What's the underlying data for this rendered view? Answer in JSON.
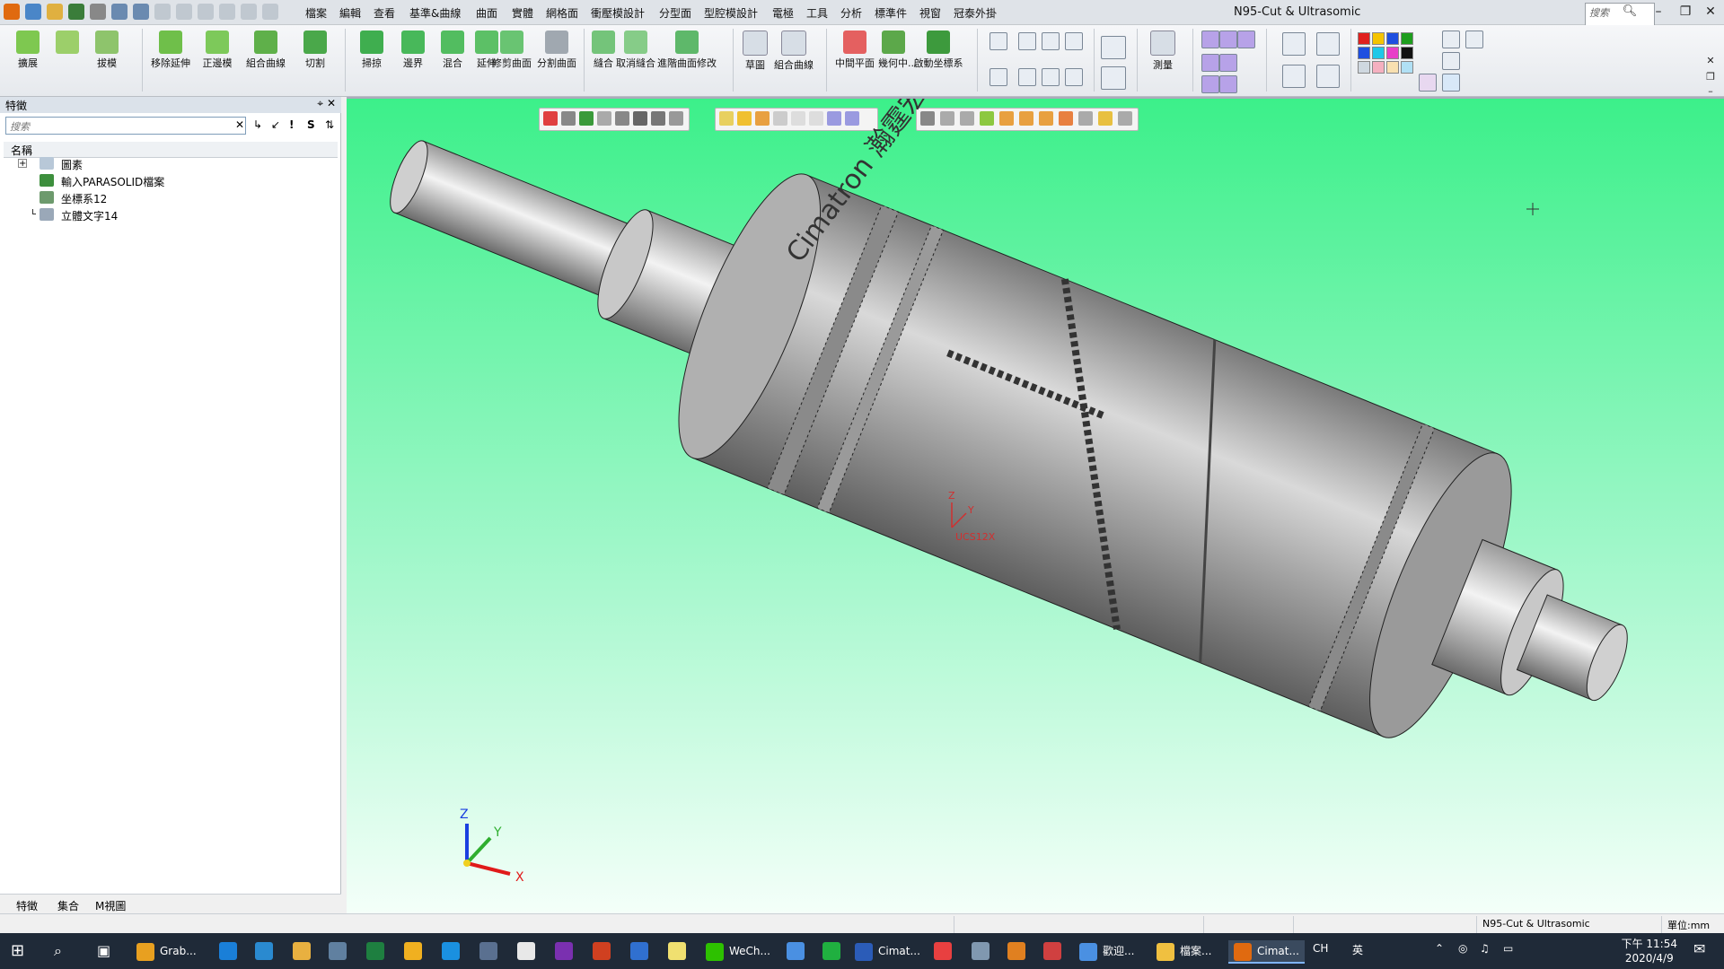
{
  "window": {
    "title": "N95-Cut & Ultrasomic"
  },
  "menubar": {
    "items": [
      "檔案",
      "編輯",
      "查看",
      "基準&曲線",
      "曲面",
      "實體",
      "網格面",
      "衝壓模設計",
      "分型面",
      "型腔模設計",
      "電極",
      "工具",
      "分析",
      "標準件",
      "視窗",
      "冠泰外掛"
    ],
    "search_placeholder": "搜索"
  },
  "ribbon": {
    "groups": [
      {
        "label": "擴展",
        "icon": "extend-icon"
      },
      {
        "label": "拔模",
        "icon": "draft-icon"
      },
      {
        "label": "移除延伸",
        "icon": "remove-extension-icon"
      },
      {
        "label": "正邊模",
        "icon": "edge-icon"
      },
      {
        "label": "組合曲線",
        "icon": "composite-curve-icon"
      },
      {
        "label": "切割",
        "icon": "cut-icon"
      },
      {
        "label": "掃掠",
        "icon": "sweep-icon"
      },
      {
        "label": "邊界",
        "icon": "boundary-icon"
      },
      {
        "label": "混合",
        "icon": "blend-icon"
      },
      {
        "label": "延伸",
        "icon": "extend-surface-icon"
      },
      {
        "label": "修剪曲面",
        "icon": "trim-surface-icon"
      },
      {
        "label": "分割曲面",
        "icon": "split-surface-icon"
      },
      {
        "label": "縫合",
        "icon": "stitch-icon"
      },
      {
        "label": "取消縫合",
        "icon": "unstitch-icon"
      },
      {
        "label": "進階曲面修改",
        "icon": "advanced-surface-icon"
      },
      {
        "label": "草圖",
        "icon": "sketch-icon"
      },
      {
        "label": "組合曲線",
        "icon": "combine-curve-icon"
      },
      {
        "label": "中間平面",
        "icon": "mid-plane-icon"
      },
      {
        "label": "幾何中...",
        "icon": "geometry-center-icon"
      },
      {
        "label": "啟動坐標系",
        "icon": "activate-ucs-icon"
      },
      {
        "label": "測量",
        "icon": "measure-icon"
      }
    ],
    "colors": [
      "#e0201e",
      "#f5c400",
      "#1e4fe0",
      "#1e9e1e",
      "#1e4fe0",
      "#1ec8e8",
      "#e83ec8",
      "#111111",
      "#cfd8e0",
      "#f5b0c0",
      "#f8e0b0",
      "#b0e0f5"
    ]
  },
  "panel": {
    "title": "特徵",
    "search_placeholder": "搜索",
    "column_header": "名稱",
    "tree": [
      {
        "label": "圖素",
        "icon": "entities-icon",
        "expandable": true
      },
      {
        "label": "輸入PARASOLID檔案",
        "icon": "import-parasolid-icon",
        "expandable": false
      },
      {
        "label": "坐標系12",
        "icon": "coordinate-system-icon",
        "expandable": false
      },
      {
        "label": "立體文字14",
        "icon": "3d-text-icon",
        "expandable": false
      }
    ],
    "tabs": [
      "特徵",
      "集合",
      "M視圖"
    ]
  },
  "viewport": {
    "part_text": "Cimatron 瀚霆宏",
    "ucs_label": "UCS12X",
    "ucs_axes": {
      "z": "Z",
      "y": "Y"
    },
    "triad": {
      "x": "X",
      "y": "Y",
      "z": "Z"
    },
    "background_top": "#3cf08a",
    "background_bottom": "#f4fff9"
  },
  "statusbar": {
    "file": "N95-Cut & Ultrasomic",
    "unit": "單位:mm"
  },
  "taskbar": {
    "apps": [
      {
        "label": "Grab...",
        "icon": "chrome-icon",
        "color": "#e8a020"
      },
      {
        "label": "WeCh...",
        "icon": "wechat-icon",
        "color": "#2dc100"
      },
      {
        "label": "Cimat...",
        "icon": "word-icon",
        "color": "#2b5cb8"
      },
      {
        "label": "歡迎...",
        "icon": "app-icon",
        "color": "#4a90e2"
      },
      {
        "label": "檔案...",
        "icon": "folder-icon",
        "color": "#f0c040"
      },
      {
        "label": "Cimat...",
        "icon": "cimatron-icon",
        "color": "#e06a10"
      }
    ],
    "tray_text": [
      "CH",
      "英"
    ],
    "time": "下午 11:54",
    "date": "2020/4/9"
  }
}
